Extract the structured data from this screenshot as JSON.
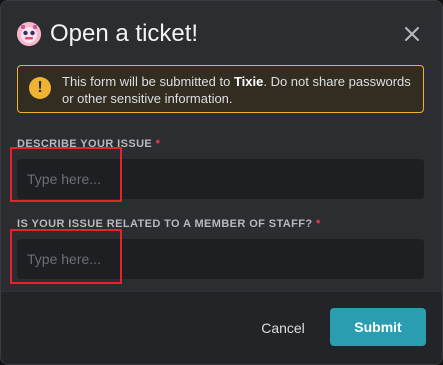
{
  "modal": {
    "title": "Open a ticket!",
    "icon": "bot-avatar-icon"
  },
  "warning": {
    "prefix": "This form will be submitted to ",
    "bot_name": "Tixie",
    "suffix": ". Do not share passwords or other sensitive information.",
    "icon": "exclamation-icon"
  },
  "fields": [
    {
      "label": "DESCRIBE YOUR ISSUE",
      "required_mark": "*",
      "placeholder": "Type here...",
      "value": ""
    },
    {
      "label": "IS YOUR ISSUE RELATED TO A MEMBER OF STAFF?",
      "required_mark": "*",
      "placeholder": "Type here...",
      "value": ""
    }
  ],
  "footer": {
    "cancel_label": "Cancel",
    "submit_label": "Submit"
  },
  "colors": {
    "accent": "#2a9db0",
    "warning": "#f0b232",
    "required": "#f23f43",
    "highlight": "#e3242b"
  }
}
